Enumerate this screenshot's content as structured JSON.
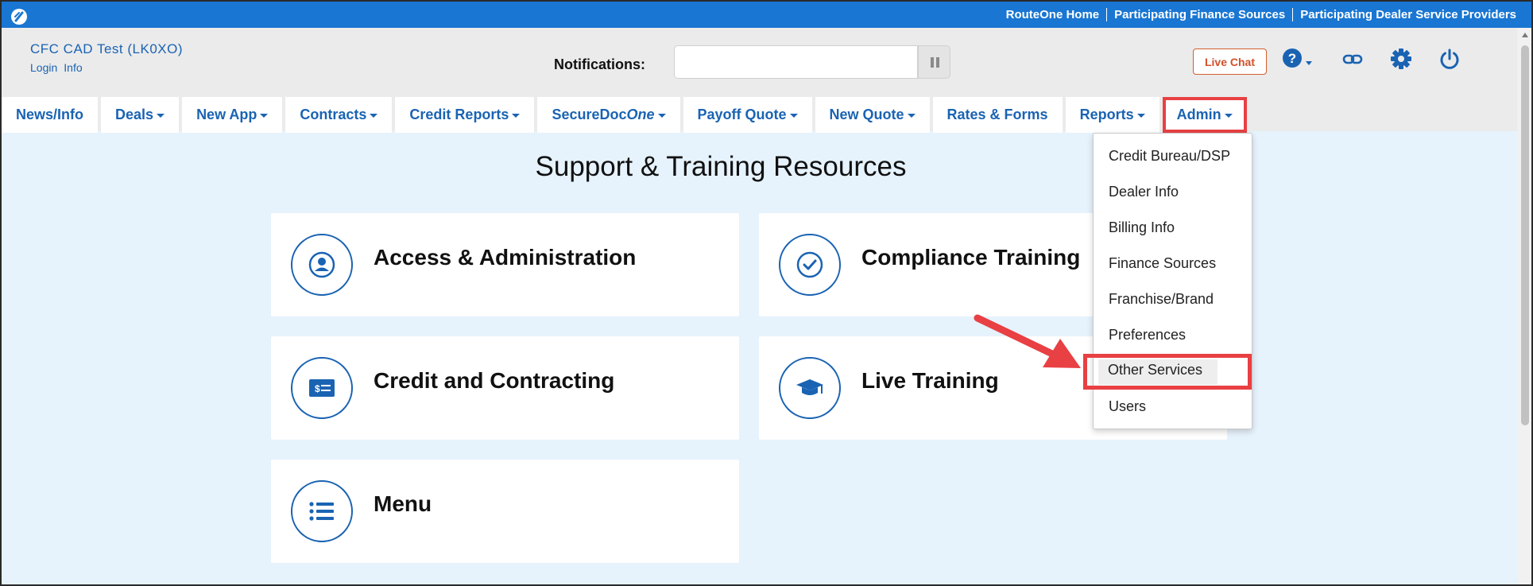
{
  "topbar": {
    "links": [
      "RouteOne Home",
      "Participating Finance Sources",
      "Participating Dealer Service Providers"
    ]
  },
  "account": {
    "name": "CFC CAD Test (LK0XO)",
    "login_link": "Login",
    "info_link": "Info"
  },
  "notifications": {
    "label": "Notifications:",
    "value": ""
  },
  "header_actions": {
    "live_chat": "Live Chat",
    "icons": [
      "help-icon",
      "link-icon",
      "gear-icon",
      "power-icon"
    ]
  },
  "nav": {
    "tabs": [
      {
        "label": "News/Info",
        "dropdown": false
      },
      {
        "label": "Deals",
        "dropdown": true
      },
      {
        "label": "New App",
        "dropdown": true
      },
      {
        "label": "Contracts",
        "dropdown": true
      },
      {
        "label": "Credit Reports",
        "dropdown": true
      },
      {
        "label": "SecureDoc",
        "label_italic": "One",
        "dropdown": true
      },
      {
        "label": "Payoff Quote",
        "dropdown": true
      },
      {
        "label": "New Quote",
        "dropdown": true
      },
      {
        "label": "Rates & Forms",
        "dropdown": false
      },
      {
        "label": "Reports",
        "dropdown": true
      },
      {
        "label": "Admin",
        "dropdown": true,
        "active": true
      }
    ]
  },
  "main": {
    "title": "Support & Training Resources",
    "cards": [
      {
        "label": "Access & Administration",
        "icon": "user-icon"
      },
      {
        "label": "Compliance Training",
        "icon": "check-icon"
      },
      {
        "label": "Credit and Contracting",
        "icon": "money-card-icon"
      },
      {
        "label": "Live Training",
        "icon": "graduation-cap-icon"
      },
      {
        "label": "Menu",
        "icon": "list-icon"
      }
    ]
  },
  "admin_menu": {
    "items": [
      "Credit Bureau/DSP",
      "Dealer Info",
      "Billing Info",
      "Finance Sources",
      "Franchise/Brand",
      "Preferences",
      "Other Services",
      "Users"
    ],
    "highlighted": "Other Services"
  },
  "colors": {
    "brand_blue": "#1976d2",
    "link_blue": "#1a63b3",
    "highlight_red": "#e84043",
    "page_bg": "#e6f2fc"
  }
}
